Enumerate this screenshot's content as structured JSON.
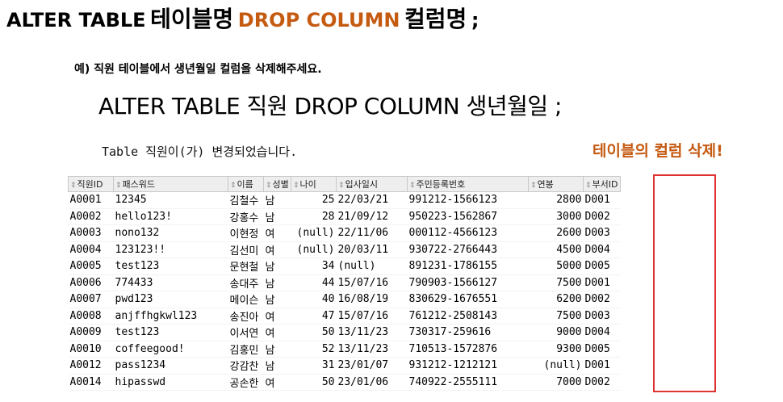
{
  "title": {
    "prefix": "ALTER TABLE",
    "table_word": "테이블명",
    "drop_column": "DROP COLUMN",
    "column_word": "컬럼명",
    "suffix": ";"
  },
  "example_label": "예) 직원 테이블에서 생년월일 컬럼을 삭제해주세요.",
  "sql_statement": "ALTER TABLE 직원 DROP COLUMN 생년월일 ;",
  "result_message": "Table 직원이(가) 변경되었습니다.",
  "annotation": "테이블의 컬럼 삭제!",
  "colors": {
    "accent": "#c55a11",
    "highlight_border": "#e03131",
    "header_bg": "#eeeeee"
  },
  "grid": {
    "columns": [
      "직원ID",
      "패스워드",
      "이름",
      "성별",
      "나이",
      "입사일시",
      "주민등록번호",
      "연봉",
      "부서ID"
    ],
    "rows": [
      [
        "A0001",
        "12345",
        "김철수",
        "남",
        "25",
        "22/03/21",
        "991212-1566123",
        "2800",
        "D001"
      ],
      [
        "A0002",
        "hello123!",
        "강홍수",
        "남",
        "28",
        "21/09/12",
        "950223-1562867",
        "3000",
        "D002"
      ],
      [
        "A0003",
        "nono132",
        "이현정",
        "여",
        "(null)",
        "22/11/06",
        "000112-4566123",
        "2600",
        "D003"
      ],
      [
        "A0004",
        "123123!!",
        "김선미",
        "여",
        "(null)",
        "20/03/11",
        "930722-2766443",
        "4500",
        "D004"
      ],
      [
        "A0005",
        "test123",
        "문현철",
        "남",
        "34",
        "(null)",
        "891231-1786155",
        "5000",
        "D005"
      ],
      [
        "A0006",
        "774433",
        "송대주",
        "남",
        "44",
        "15/07/16",
        "790903-1566127",
        "7500",
        "D001"
      ],
      [
        "A0007",
        "pwd123",
        "메이슨",
        "남",
        "40",
        "16/08/19",
        "830629-1676551",
        "6200",
        "D002"
      ],
      [
        "A0008",
        "anjffhgkwl123",
        "송진아",
        "여",
        "47",
        "15/07/16",
        "761212-2508143",
        "7500",
        "D003"
      ],
      [
        "A0009",
        "test123",
        "이서연",
        "여",
        "50",
        "13/11/23",
        "730317-259616",
        "9000",
        "D004"
      ],
      [
        "A0010",
        "coffeegood!",
        "김홍민",
        "남",
        "52",
        "13/11/23",
        "710513-1572876",
        "9300",
        "D005"
      ],
      [
        "A0012",
        "pass1234",
        "강감찬",
        "남",
        "31",
        "23/01/07",
        "931212-1212121",
        "(null)",
        "D001"
      ],
      [
        "A0014",
        "hipasswd",
        "공손한",
        "여",
        "50",
        "23/01/06",
        "740922-2555111",
        "7000",
        "D002"
      ]
    ]
  }
}
